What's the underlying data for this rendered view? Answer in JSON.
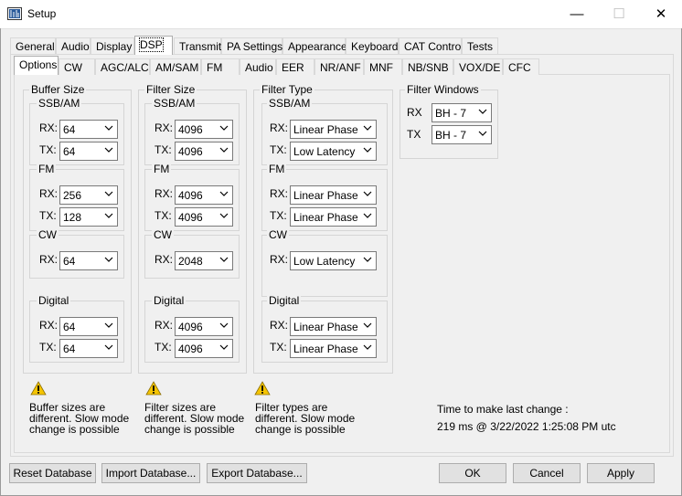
{
  "window": {
    "title": "Setup",
    "minimize": "—",
    "maximize": "☐",
    "close": "✕"
  },
  "main_tabs": [
    {
      "label": "General"
    },
    {
      "label": "Audio"
    },
    {
      "label": "Display"
    },
    {
      "label": "DSP"
    },
    {
      "label": "Transmit"
    },
    {
      "label": "PA Settings"
    },
    {
      "label": "Appearance"
    },
    {
      "label": "Keyboard"
    },
    {
      "label": "CAT Control"
    },
    {
      "label": "Tests"
    }
  ],
  "sub_tabs": [
    {
      "label": "Options"
    },
    {
      "label": "CW"
    },
    {
      "label": "AGC/ALC"
    },
    {
      "label": "AM/SAM"
    },
    {
      "label": "FM"
    },
    {
      "label": "Audio"
    },
    {
      "label": "EER"
    },
    {
      "label": "NR/ANF"
    },
    {
      "label": "MNF"
    },
    {
      "label": "NB/SNB"
    },
    {
      "label": "VOX/DE"
    },
    {
      "label": "CFC"
    }
  ],
  "labels": {
    "rx": "RX:",
    "tx": "TX:"
  },
  "buffer_size": {
    "title": "Buffer Size",
    "ssb": {
      "title": "SSB/AM",
      "rx": "64",
      "tx": "64"
    },
    "fm": {
      "title": "FM",
      "rx": "256",
      "tx": "128"
    },
    "cw": {
      "title": "CW",
      "rx": "64"
    },
    "digital": {
      "title": "Digital",
      "rx": "64",
      "tx": "64"
    }
  },
  "filter_size": {
    "title": "Filter Size",
    "ssb": {
      "title": "SSB/AM",
      "rx": "4096",
      "tx": "4096"
    },
    "fm": {
      "title": "FM",
      "rx": "4096",
      "tx": "4096"
    },
    "cw": {
      "title": "CW",
      "rx": "2048"
    },
    "digital": {
      "title": "Digital",
      "rx": "4096",
      "tx": "4096"
    }
  },
  "filter_type": {
    "title": "Filter Type",
    "ssb": {
      "title": "SSB/AM",
      "rx": "Linear Phase",
      "tx": "Low Latency"
    },
    "fm": {
      "title": "FM",
      "rx": "Linear Phase",
      "tx": "Linear Phase"
    },
    "cw": {
      "title": "CW",
      "rx": "Low Latency"
    },
    "digital": {
      "title": "Digital",
      "rx": "Linear Phase",
      "tx": "Linear Phase"
    }
  },
  "filter_windows": {
    "title": "Filter Windows",
    "rx_label": "RX",
    "tx_label": "TX",
    "rx": "BH - 7",
    "tx": "BH - 7"
  },
  "warnings": {
    "buffer": [
      "Buffer sizes are",
      "different. Slow mode",
      "change is possible"
    ],
    "filter": [
      "Filter sizes are",
      "different. Slow mode",
      "change is possible"
    ],
    "type": [
      "Filter types are",
      "different. Slow mode",
      "change is possible"
    ]
  },
  "timing": {
    "label": "Time to make last change :",
    "value": "219 ms @ 3/22/2022 1:25:08 PM utc"
  },
  "buttons": {
    "reset": "Reset Database",
    "import": "Import Database...",
    "export": "Export Database...",
    "ok": "OK",
    "cancel": "Cancel",
    "apply": "Apply"
  },
  "colors": {
    "accent_warning": "#f5c400",
    "window_bg": "#f0f0f0"
  }
}
